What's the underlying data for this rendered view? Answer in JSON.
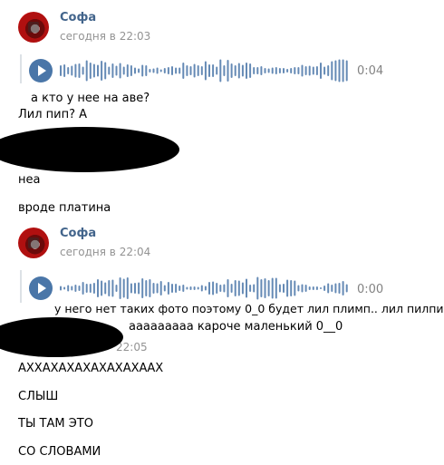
{
  "messages_group_1": {
    "author": "Софа",
    "time": "сегодня в 22:03",
    "voice": {
      "duration": "0:04",
      "progress": 0
    },
    "lines": [
      "а кто у нее на аве?",
      "Лил пип? А",
      "неа",
      "вроде платина"
    ]
  },
  "messages_group_2": {
    "author": "Софа",
    "time": "сегодня в 22:04",
    "voice": {
      "duration": "0:00",
      "progress": 0
    },
    "lines": [
      "у него нет таких фото поэтому 0_0 будет лил плимп.. лил пилпи",
      "ааааааааа кароче маленький 0__0"
    ]
  },
  "messages_group_3": {
    "time_partial": "22:05",
    "lines": [
      "АХХАХАХАХАХАХАХААХ",
      "СЛЫШ",
      "ТЫ ТАМ ЭТО",
      "СО СЛОВАМИ"
    ]
  },
  "colors": {
    "author": "#42648b",
    "accent": "#4a76a8",
    "muted": "#939393",
    "wave": "#4a76a8"
  },
  "icons": {
    "play": "play-icon",
    "avatar": "avatar-image"
  }
}
